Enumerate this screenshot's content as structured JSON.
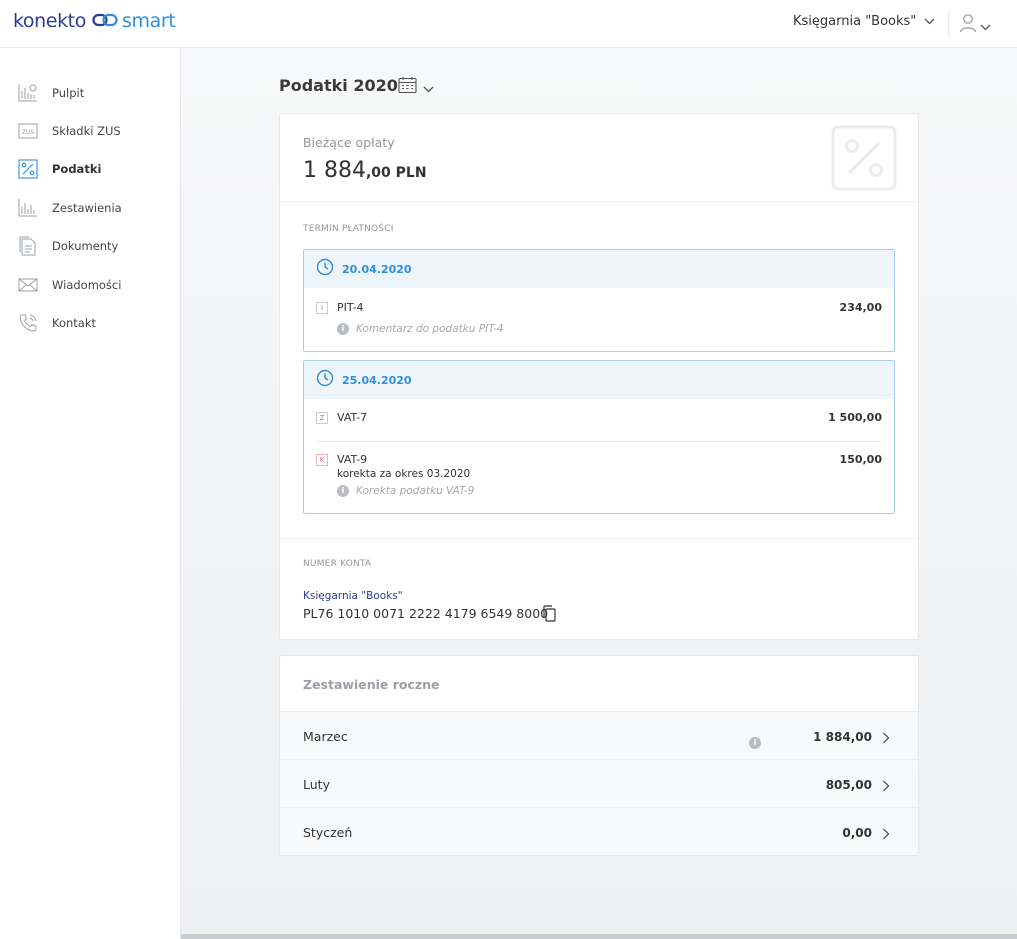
{
  "header": {
    "logo_part1": "konekto",
    "logo_part2": "smart",
    "company": "Księgarnia \"Books\""
  },
  "sidebar": {
    "items": [
      {
        "label": "Pulpit",
        "icon": "dashboard-icon"
      },
      {
        "label": "Składki ZUS",
        "icon": "zus-icon"
      },
      {
        "label": "Podatki",
        "icon": "percent-icon",
        "active": true
      },
      {
        "label": "Zestawienia",
        "icon": "bar-chart-icon"
      },
      {
        "label": "Dokumenty",
        "icon": "documents-icon"
      },
      {
        "label": "Wiadomości",
        "icon": "envelope-icon"
      },
      {
        "label": "Kontakt",
        "icon": "phone-icon"
      }
    ]
  },
  "page": {
    "title": "Podatki 2020"
  },
  "current": {
    "label": "Bieżące opłaty",
    "amount_main": "1 884",
    "amount_decimals": ",00 PLN"
  },
  "due_section": {
    "label": "TERMIN PŁATNOŚCI",
    "groups": [
      {
        "date": "20.04.2020",
        "items": [
          {
            "badge": "I",
            "name": "PIT-4",
            "value": "234,00",
            "comment": "Komentarz do podatku PIT-4"
          }
        ]
      },
      {
        "date": "25.04.2020",
        "items": [
          {
            "badge": "Z",
            "name": "VAT-7",
            "value": "1 500,00"
          },
          {
            "badge": "K",
            "name": "VAT-9",
            "sub": "korekta za okres 03.2020",
            "value": "150,00",
            "comment": "Korekta podatku VAT-9"
          }
        ]
      }
    ]
  },
  "account": {
    "label": "NUMER KONTA",
    "name": "Księgarnia \"Books\"",
    "number": "PL76 1010 0071 2222 4179 6549 8000"
  },
  "summary": {
    "title": "Zestawienie roczne",
    "rows": [
      {
        "month": "Marzec",
        "value": "1 884,00",
        "info": true
      },
      {
        "month": "Luty",
        "value": "805,00"
      },
      {
        "month": "Styczeń",
        "value": "0,00"
      }
    ]
  },
  "colors": {
    "brand_dark": "#2a3d8f",
    "brand_light": "#2f8fd8",
    "due_border": "#a8cfe8",
    "due_head_bg": "#edf5fb"
  }
}
